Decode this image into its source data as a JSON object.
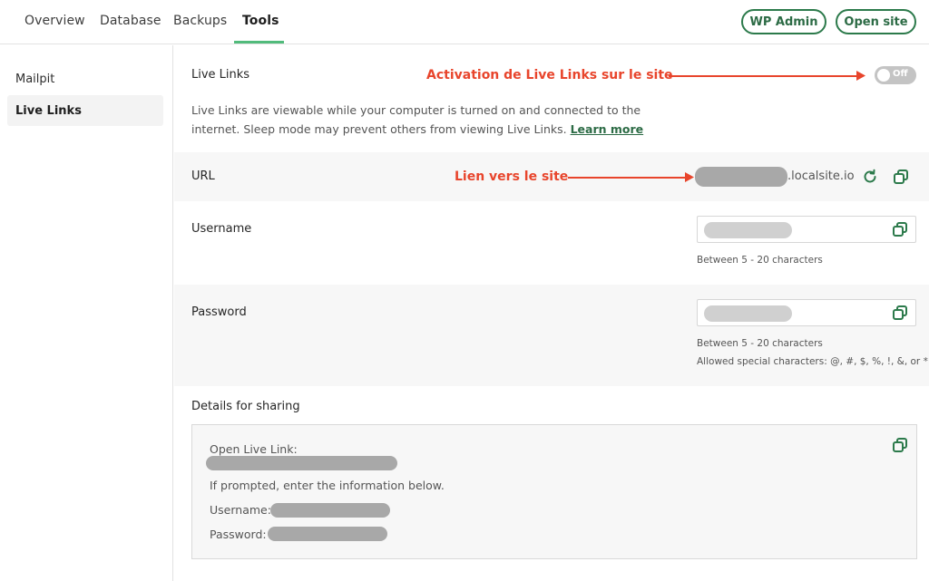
{
  "nav": {
    "tabs": [
      {
        "label": "Overview"
      },
      {
        "label": "Database"
      },
      {
        "label": "Backups"
      },
      {
        "label": "Tools"
      }
    ],
    "wp_admin_label": "WP Admin",
    "open_site_label": "Open site"
  },
  "sidebar": {
    "items": [
      {
        "label": "Mailpit"
      },
      {
        "label": "Live Links"
      }
    ]
  },
  "live_links": {
    "title": "Live Links",
    "toggle_state": "Off",
    "description": "Live Links are viewable while your computer is turned on and connected to the internet. Sleep mode may prevent others from viewing Live Links.",
    "learn_more": "Learn more"
  },
  "url": {
    "label": "URL",
    "suffix": ".localsite.io"
  },
  "username": {
    "label": "Username",
    "hint": "Between 5 - 20 characters"
  },
  "password": {
    "label": "Password",
    "hint1": "Between 5 - 20 characters",
    "hint2": "Allowed special characters: @, #, $, %, !, &, or *"
  },
  "sharing": {
    "title": "Details for sharing",
    "open_label": "Open Live Link:",
    "prompt": "If prompted, enter the information below.",
    "username_label": "Username:",
    "password_label": "Password:"
  },
  "annotations": {
    "activation": "Activation de Live Links sur le site",
    "link": "Lien vers le site"
  },
  "colors": {
    "accent": "#2c7a4b",
    "tab_underline": "#51bb7b",
    "annotation": "#e8452c"
  }
}
